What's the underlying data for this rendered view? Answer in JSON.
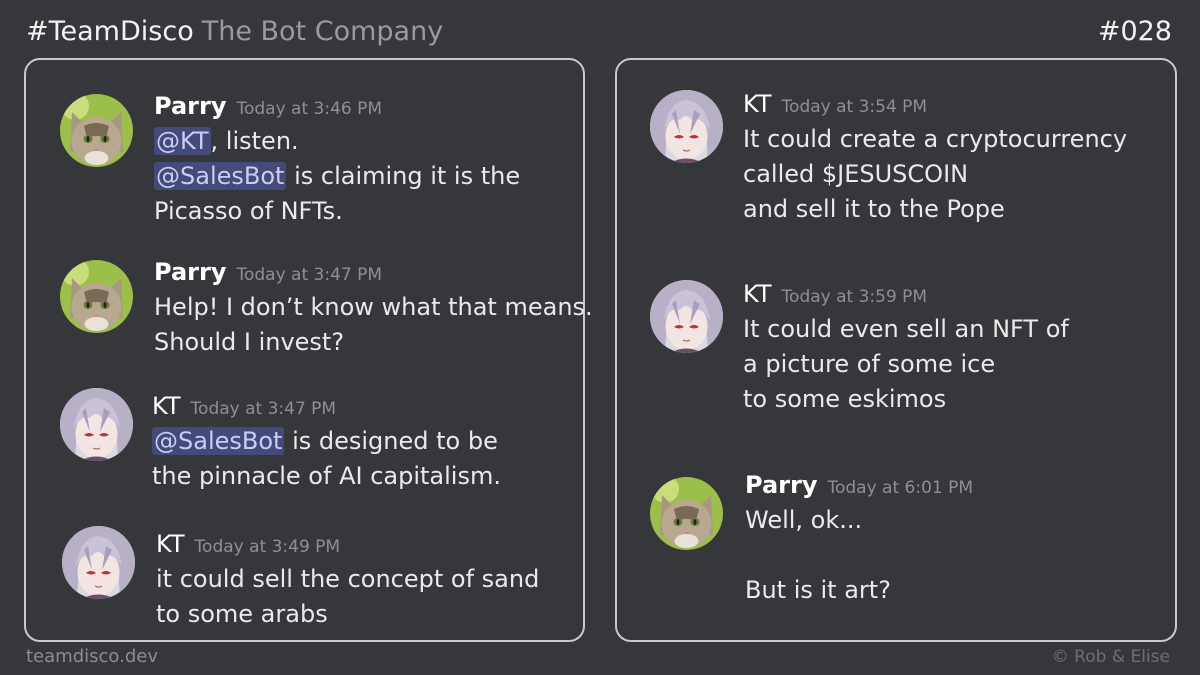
{
  "header": {
    "hash_title": "#TeamDisco",
    "sub_title": "The Bot Company",
    "issue": "#028"
  },
  "footer": {
    "site": "teamdisco.dev",
    "credit": "©  Rob & Elise"
  },
  "colors": {
    "background": "#36373b",
    "mention_bg": "#444a7a",
    "panel_border": "#c9c9cc"
  },
  "left_panel": {
    "messages": [
      {
        "author": "Parry",
        "avatar": "cat-avatar",
        "time": "Today at 3:46 PM",
        "mention1": "@KT",
        "line1_rest": ", listen.",
        "mention2": "@SalesBot",
        "line2_rest": " is claiming it is the",
        "line3": "Picasso of NFTs."
      },
      {
        "author": "Parry",
        "avatar": "cat-avatar",
        "time": "Today at 3:47 PM",
        "line1": "Help!  I don’t know what that means.",
        "line2": "Should I invest?"
      },
      {
        "author": "KT",
        "avatar": "anime-girl-avatar",
        "time": "Today at 3:47 PM",
        "mention1": "@SalesBot",
        "line1_rest": " is designed to be",
        "line2": "the pinnacle of AI capitalism."
      },
      {
        "author": "KT",
        "avatar": "anime-girl-avatar",
        "time": "Today at 3:49 PM",
        "line1": "it could sell the concept of sand",
        "line2": "to some arabs"
      }
    ]
  },
  "right_panel": {
    "messages": [
      {
        "author": "KT",
        "avatar": "anime-girl-avatar",
        "time": "Today at 3:54 PM",
        "line1": "It could create a cryptocurrency",
        "line2": "called $JESUSCOIN",
        "line3": "and sell it to the Pope"
      },
      {
        "author": "KT",
        "avatar": "anime-girl-avatar",
        "time": "Today at 3:59 PM",
        "line1": "It could even sell an NFT of",
        "line2": "a picture of some ice",
        "line3": "to some eskimos"
      },
      {
        "author": "Parry",
        "avatar": "cat-avatar",
        "time": "Today at 6:01 PM",
        "line1": "Well, ok...",
        "line2": "",
        "line3": "But is it art?"
      }
    ]
  }
}
